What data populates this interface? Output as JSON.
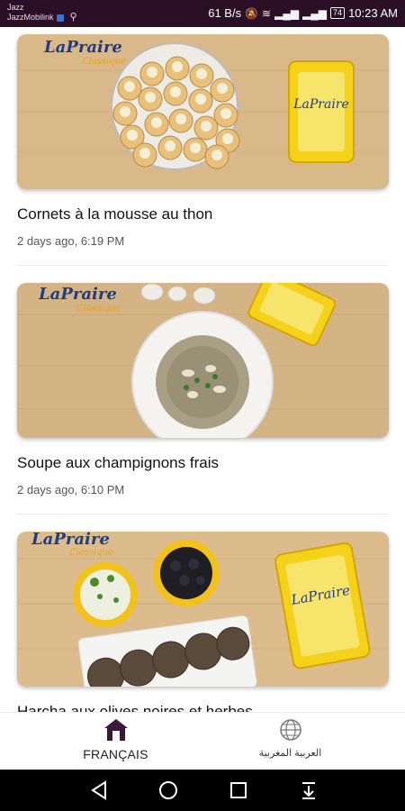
{
  "status_bar": {
    "carrier_line1": "Jazz",
    "carrier_line2": "JazzMobilink",
    "speed": "61 B/s",
    "battery": "74",
    "time": "10:23 AM"
  },
  "recipes": [
    {
      "title": "Cornets à la mousse au thon",
      "date": "2 days ago, 6:19 PM",
      "brand": "LaPraire"
    },
    {
      "title": "Soupe aux champignons frais",
      "date": "2 days ago, 6:10 PM",
      "brand": "LaPraire"
    },
    {
      "title": "Harcha aux olives noires et herbes",
      "date": "",
      "brand": "LaPraire"
    }
  ],
  "bottom_nav": {
    "french_label": "FRANÇAIS",
    "arabic_label": "العربية المغربية"
  },
  "colors": {
    "status_bar": "#2a0f26",
    "accent": "#3a1a3a",
    "wood": "#d9b98a"
  },
  "icons": [
    "home-icon",
    "globe-icon",
    "back-icon",
    "home-circle-icon",
    "recents-icon",
    "notifications-pull-icon"
  ]
}
